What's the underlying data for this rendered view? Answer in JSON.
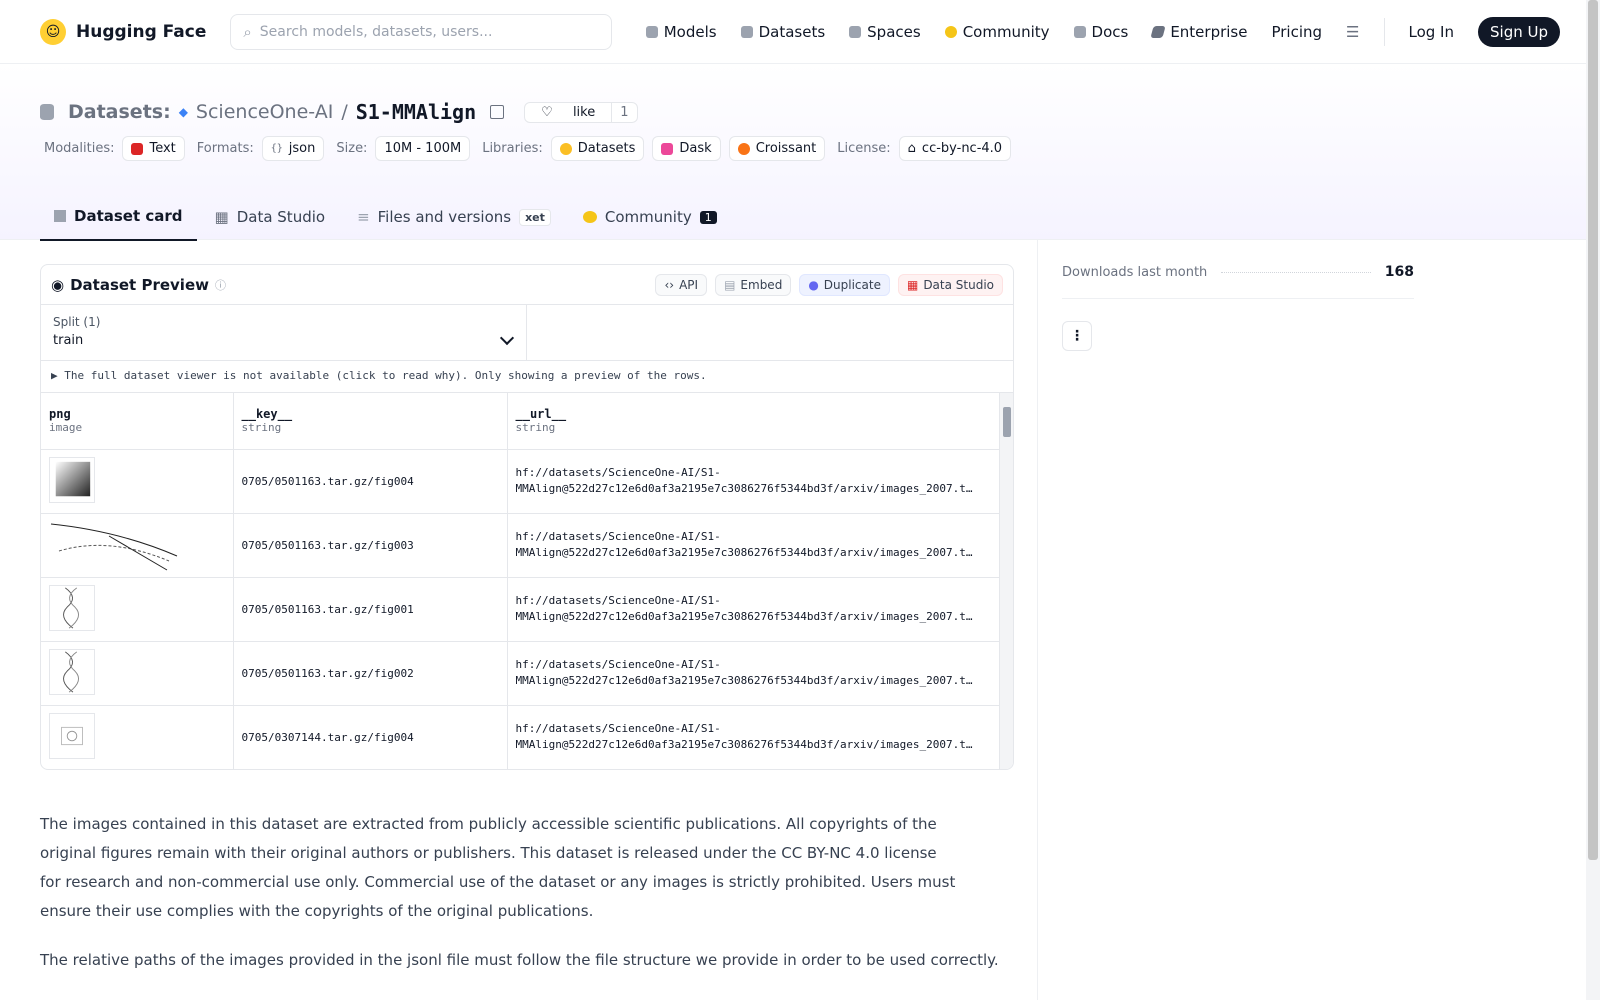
{
  "nav": {
    "brand": "Hugging Face",
    "search_placeholder": "Search models, datasets, users...",
    "links": [
      {
        "label": "Models",
        "icon": "cube-icon",
        "color": "#9ca3af"
      },
      {
        "label": "Datasets",
        "icon": "database-icon",
        "color": "#9ca3af"
      },
      {
        "label": "Spaces",
        "icon": "grid-icon",
        "color": "#9ca3af"
      },
      {
        "label": "Community",
        "icon": "chat-icon",
        "color": "#f5c518"
      },
      {
        "label": "Docs",
        "icon": "book-icon",
        "color": "#9ca3af"
      },
      {
        "label": "Enterprise",
        "icon": "enterprise-icon",
        "color": "#6b7280"
      },
      {
        "label": "Pricing"
      }
    ],
    "login": "Log In",
    "signup": "Sign Up"
  },
  "header": {
    "category": "Datasets:",
    "org": "ScienceOne-AI",
    "sep": "/",
    "repo": "S1-MMAlign",
    "like_label": "like",
    "like_count": "1",
    "tags": {
      "modalities_label": "Modalities:",
      "modalities": "Text",
      "formats_label": "Formats:",
      "formats": "json",
      "size_label": "Size:",
      "size": "10M - 100M",
      "libraries_label": "Libraries:",
      "libraries": [
        "Datasets",
        "Dask",
        "Croissant"
      ],
      "license_label": "License:",
      "license": "cc-by-nc-4.0"
    },
    "tabs": {
      "dataset_card": "Dataset card",
      "data_studio": "Data Studio",
      "files": "Files and versions",
      "xet": "xet",
      "community": "Community",
      "community_count": "1"
    }
  },
  "preview": {
    "title": "Dataset Preview",
    "buttons": {
      "api": "API",
      "embed": "Embed",
      "duplicate": "Duplicate",
      "data_studio": "Data Studio"
    },
    "split_label": "Split (1)",
    "split_value": "train",
    "notice": "▶ The full dataset viewer is not available (click to read why). Only showing a preview of the rows.",
    "columns": [
      {
        "name": "png",
        "type": "image"
      },
      {
        "name": "__key__",
        "type": "string"
      },
      {
        "name": "__url__",
        "type": "string"
      }
    ],
    "rows": [
      {
        "key": "0705/0501163.tar.gz/fig004",
        "url1": "hf://datasets/ScienceOne-AI/S1-",
        "url2": "MMAlign@522d27c12e6d0af3a2195e7c3086276f5344bd3f/arxiv/images_2007.t…"
      },
      {
        "key": "0705/0501163.tar.gz/fig003",
        "url1": "hf://datasets/ScienceOne-AI/S1-",
        "url2": "MMAlign@522d27c12e6d0af3a2195e7c3086276f5344bd3f/arxiv/images_2007.t…"
      },
      {
        "key": "0705/0501163.tar.gz/fig001",
        "url1": "hf://datasets/ScienceOne-AI/S1-",
        "url2": "MMAlign@522d27c12e6d0af3a2195e7c3086276f5344bd3f/arxiv/images_2007.t…"
      },
      {
        "key": "0705/0501163.tar.gz/fig002",
        "url1": "hf://datasets/ScienceOne-AI/S1-",
        "url2": "MMAlign@522d27c12e6d0af3a2195e7c3086276f5344bd3f/arxiv/images_2007.t…"
      },
      {
        "key": "0705/0307144.tar.gz/fig004",
        "url1": "hf://datasets/ScienceOne-AI/S1-",
        "url2": "MMAlign@522d27c12e6d0af3a2195e7c3086276f5344bd3f/arxiv/images_2007.t…"
      }
    ]
  },
  "body": {
    "para1": "The images contained in this dataset are extracted from publicly accessible scientific publications. All copyrights of the original figures remain with their original authors or publishers. This dataset is released under the CC BY-NC 4.0 license for research and non-commercial use only. Commercial use of the dataset or any images is strictly prohibited. Users must ensure their use complies with the copyrights of the original publications.",
    "para2": "The relative paths of the images provided in the jsonl file must follow the file structure we provide in order to be used correctly."
  },
  "sidebar": {
    "downloads_label": "Downloads last month",
    "downloads_value": "168"
  }
}
